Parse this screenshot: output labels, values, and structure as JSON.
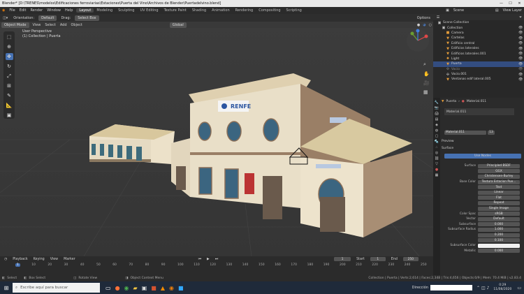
{
  "window": {
    "title": "Blender* [D:\\TRENES\\modelos\\Edificaciones ferroviarias\\Estaciones\\Puerta del Vino\\Archivos de Blender\\Puertadelvino.blend]"
  },
  "menu": {
    "items": [
      "File",
      "Edit",
      "Render",
      "Window",
      "Help"
    ]
  },
  "workspaces": {
    "items": [
      "Layout",
      "Modeling",
      "Sculpting",
      "UV Editing",
      "Texture Paint",
      "Shading",
      "Animation",
      "Rendering",
      "Compositing",
      "Scripting"
    ],
    "active": "Layout"
  },
  "scene": {
    "label": "Scene",
    "view_layer": "View Layer"
  },
  "viewport_header": {
    "orientation_label": "Orientation:",
    "orientation_value": "Default",
    "drag_label": "Drag:",
    "drag_value": "Select Box",
    "mode": "Object Mode",
    "view": "View",
    "select": "Select",
    "add": "Add",
    "object": "Object",
    "transform": "Global",
    "options": "Options"
  },
  "viewport_info": {
    "perspective": "User Perspective",
    "collection": "(1) Collection | Puerta"
  },
  "building_sign": "RENFE",
  "outliner": {
    "root": "Scene Collection",
    "collection": "Collection",
    "items": [
      "Camera",
      "Cartelas",
      "Edificio central",
      "Edificios laterales",
      "Edificios laterales.001",
      "Light",
      "Puerta",
      "Vacio",
      "Vacio.001",
      "Ventanas edif lateral.005"
    ]
  },
  "properties": {
    "object_name": "Puerta",
    "material_name": "Material.011",
    "slot": "Material.011",
    "datablock": "Material.011",
    "users": "13",
    "preview": "Preview",
    "surface": "Surface",
    "use_nodes": "Use Nodes",
    "fields": [
      {
        "label": "Surface",
        "value": "Principled BSDF"
      },
      {
        "label": "",
        "value": "GGX"
      },
      {
        "label": "",
        "value": "Christensen-Burley"
      },
      {
        "label": "Base Color",
        "value": "Textura Estacion Pue..."
      },
      {
        "label": "",
        "value": "Text"
      },
      {
        "label": "",
        "value": "Linear"
      },
      {
        "label": "",
        "value": "Flat"
      },
      {
        "label": "",
        "value": "Repeat"
      },
      {
        "label": "",
        "value": "Single Image"
      },
      {
        "label": "Color Spac",
        "value": "sRGB"
      },
      {
        "label": "Vector",
        "value": "Default"
      },
      {
        "label": "Subsurface",
        "value": "0.000"
      },
      {
        "label": "Subsurface Radius",
        "value": "1.000"
      },
      {
        "label": "",
        "value": "0.200"
      },
      {
        "label": "",
        "value": "0.100"
      },
      {
        "label": "Subsurface Color",
        "value": ""
      },
      {
        "label": "Metallic",
        "value": "0.000"
      }
    ]
  },
  "timeline": {
    "playback": "Playback",
    "keying": "Keying",
    "view": "View",
    "marker": "Marker",
    "current_frame": "1",
    "start_label": "Start",
    "start": "1",
    "end_label": "End",
    "end": "250",
    "ticks": [
      "1",
      "10",
      "20",
      "30",
      "40",
      "50",
      "60",
      "70",
      "80",
      "90",
      "100",
      "110",
      "120",
      "130",
      "140",
      "150",
      "160",
      "170",
      "180",
      "190",
      "200",
      "210",
      "220",
      "230",
      "240",
      "250"
    ]
  },
  "statusbar": {
    "select": "Select",
    "box_select": "Box Select",
    "rotate_view": "Rotate View",
    "context_menu": "Object Context Menu",
    "stats": "Collection | Puerta | Verts:2,614 | Faces:2,348 | Tris:4,656 | Objects:0/9 | Mem: 70.4 MiB | v2.83.4"
  },
  "taskbar": {
    "search_placeholder": "Escribe aquí para buscar",
    "direction_label": "Dirección",
    "time": "0:29",
    "date": "11/08/2020"
  }
}
